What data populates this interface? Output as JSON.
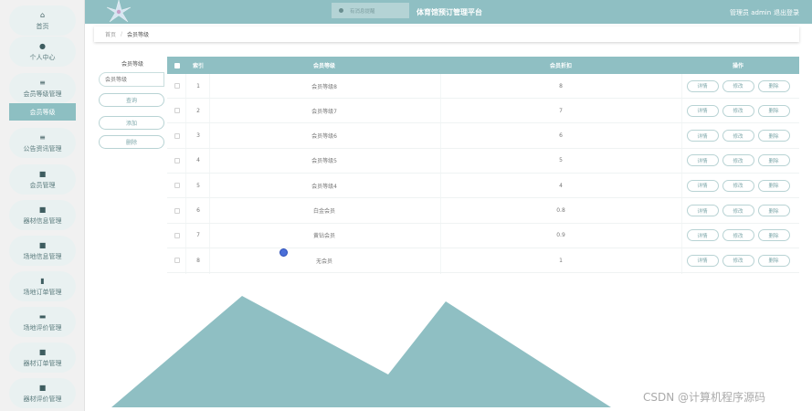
{
  "app": {
    "title": "体育馆预订管理平台"
  },
  "header": {
    "notice": "有消息提醒",
    "user": "管理员 admin",
    "logout": "退出登录"
  },
  "sidebar": {
    "items": [
      {
        "label": "首页",
        "icon": "home-icon",
        "glyph": "⌂"
      },
      {
        "label": "个人中心",
        "icon": "user-icon",
        "glyph": "●"
      },
      {
        "label": "会员等级管理",
        "icon": "menu-icon",
        "glyph": "≡"
      },
      {
        "label": "会员等级",
        "icon": "active-item",
        "glyph": ""
      },
      {
        "label": "公告资讯管理",
        "icon": "menu-icon",
        "glyph": "≡"
      },
      {
        "label": "会员管理",
        "icon": "grid-icon",
        "glyph": "■"
      },
      {
        "label": "器材信息管理",
        "icon": "grid-icon",
        "glyph": "■"
      },
      {
        "label": "场地信息管理",
        "icon": "grid-icon",
        "glyph": "■"
      },
      {
        "label": "场地订单管理",
        "icon": "chart-icon",
        "glyph": "▮"
      },
      {
        "label": "场地评价管理",
        "icon": "monitor-icon",
        "glyph": "▬"
      },
      {
        "label": "器材订单管理",
        "icon": "grid-icon",
        "glyph": "■"
      },
      {
        "label": "器材评价管理",
        "icon": "grid-icon",
        "glyph": "■"
      }
    ]
  },
  "breadcrumb": {
    "home": "首页",
    "sep": "/",
    "current": "会员等级"
  },
  "filter": {
    "label": "会员等级",
    "placeholder": "会员等级",
    "search_label": "查询",
    "add_label": "添加",
    "delete_label": "删除"
  },
  "table": {
    "headers": {
      "index": "索引",
      "level": "会员等级",
      "discount": "会员折扣",
      "ops": "操作"
    },
    "ops": {
      "detail": "详情",
      "edit": "修改",
      "delete": "删除"
    },
    "rows": [
      {
        "index": "1",
        "level": "会员等级8",
        "discount": "8"
      },
      {
        "index": "2",
        "level": "会员等级7",
        "discount": "7"
      },
      {
        "index": "3",
        "level": "会员等级6",
        "discount": "6"
      },
      {
        "index": "4",
        "level": "会员等级5",
        "discount": "5"
      },
      {
        "index": "5",
        "level": "会员等级4",
        "discount": "4"
      },
      {
        "index": "6",
        "level": "白金会员",
        "discount": "0.8"
      },
      {
        "index": "7",
        "level": "黄钻会员",
        "discount": "0.9"
      },
      {
        "index": "8",
        "level": "无会员",
        "discount": "1"
      }
    ]
  },
  "watermark": "CSDN @计算机程序源码",
  "colors": {
    "accent": "#8fbfc3",
    "nav_bg": "#e9f1f1",
    "mountain": "#8fbfc3"
  }
}
